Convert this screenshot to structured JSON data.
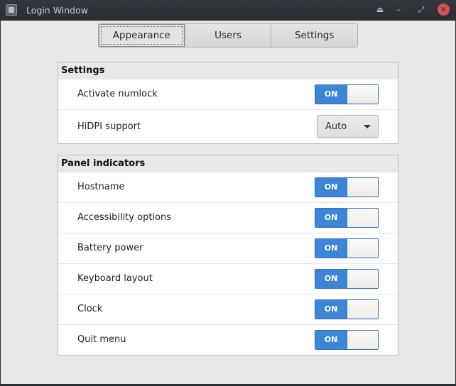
{
  "window": {
    "title": "Login Window"
  },
  "tabs": [
    {
      "label": "Appearance",
      "active": true
    },
    {
      "label": "Users",
      "active": false
    },
    {
      "label": "Settings",
      "active": false
    }
  ],
  "settings_panel": {
    "title": "Settings",
    "rows": [
      {
        "label": "Activate numlock",
        "control": "switch",
        "state": "ON"
      },
      {
        "label": "HiDPI support",
        "control": "dropdown",
        "value": "Auto"
      }
    ]
  },
  "indicators_panel": {
    "title": "Panel indicators",
    "rows": [
      {
        "label": "Hostname",
        "state": "ON"
      },
      {
        "label": "Accessibility options",
        "state": "ON"
      },
      {
        "label": "Battery power",
        "state": "ON"
      },
      {
        "label": "Keyboard layout",
        "state": "ON"
      },
      {
        "label": "Clock",
        "state": "ON"
      },
      {
        "label": "Quit menu",
        "state": "ON"
      }
    ]
  },
  "colors": {
    "accent": "#3d86d7",
    "close": "#d9534f",
    "titlebar": "#2b2e33"
  },
  "icons": {
    "app": "app-window-icon",
    "eject": "eject-icon",
    "minimize": "minimize-icon",
    "maximize": "maximize-icon",
    "close": "close-icon"
  }
}
